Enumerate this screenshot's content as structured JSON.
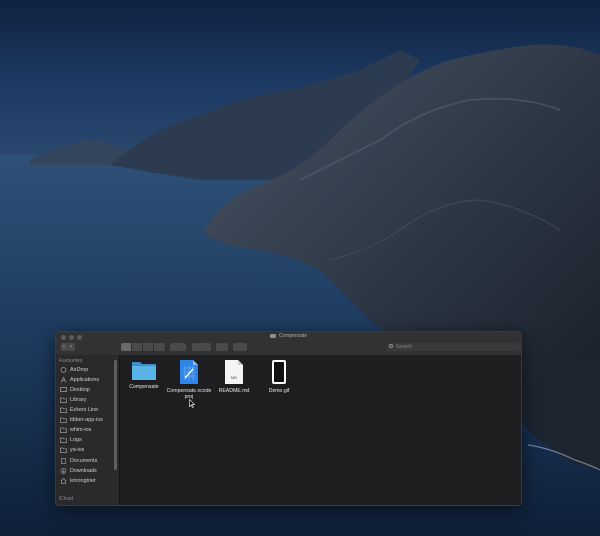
{
  "window": {
    "title": "Compensate",
    "search_placeholder": "Search"
  },
  "sidebar": {
    "favourites_heading": "Favourites",
    "items": [
      {
        "label": "AirDrop",
        "icon": "airdrop-icon"
      },
      {
        "label": "Applications",
        "icon": "applications-icon"
      },
      {
        "label": "Desktop",
        "icon": "desktop-icon"
      },
      {
        "label": "Library",
        "icon": "folder-icon"
      },
      {
        "label": "Eckers Line",
        "icon": "folder-icon"
      },
      {
        "label": "tibber-app-ios",
        "icon": "folder-icon"
      },
      {
        "label": "whim-ios",
        "icon": "folder-icon"
      },
      {
        "label": "Logs",
        "icon": "folder-icon"
      },
      {
        "label": "ya-ios",
        "icon": "folder-icon"
      },
      {
        "label": "Documents",
        "icon": "documents-icon"
      },
      {
        "label": "Downloads",
        "icon": "downloads-icon"
      },
      {
        "label": "letrongtriet",
        "icon": "home-icon"
      }
    ],
    "icloud_heading": "iCloud"
  },
  "files": [
    {
      "label": "Compensate",
      "icon": "folder-icon"
    },
    {
      "label": "Compensate.xcodeproj",
      "icon": "xcodeproj-icon"
    },
    {
      "label": "README.md",
      "icon": "markdown-file-icon",
      "badge": "MD"
    },
    {
      "label": "Demo.gif",
      "icon": "gif-file-icon"
    }
  ],
  "colors": {
    "accent_folder": "#5ab3e6",
    "xcode_blue": "#2f86e8"
  }
}
